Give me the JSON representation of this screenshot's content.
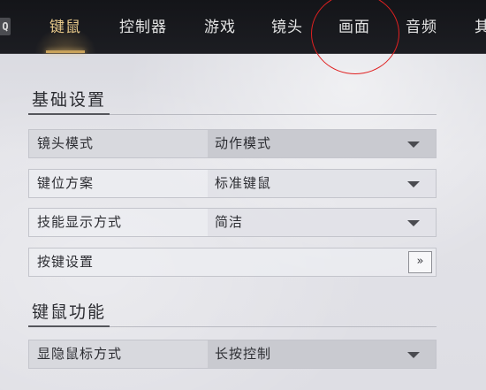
{
  "nav": {
    "shortcut_key": "Q",
    "tabs": [
      {
        "label": "键鼠",
        "active": true
      },
      {
        "label": "控制器",
        "active": false
      },
      {
        "label": "游戏",
        "active": false
      },
      {
        "label": "镜头",
        "active": false
      },
      {
        "label": "画面",
        "active": false
      },
      {
        "label": "音频",
        "active": false
      },
      {
        "label": "其",
        "active": false
      }
    ],
    "accent_color": "#c9a25a",
    "annotation_color": "#e02020"
  },
  "sections": {
    "basic": {
      "title": "基础设置",
      "rows": [
        {
          "label": "镜头模式",
          "value": "动作模式"
        },
        {
          "label": "键位方案",
          "value": "标准键鼠"
        },
        {
          "label": "技能显示方式",
          "value": "简洁"
        },
        {
          "label": "按键设置",
          "button": "»"
        }
      ]
    },
    "mouse": {
      "title": "键鼠功能",
      "rows": [
        {
          "label": "显隐鼠标方式",
          "value": "长按控制"
        }
      ]
    }
  }
}
